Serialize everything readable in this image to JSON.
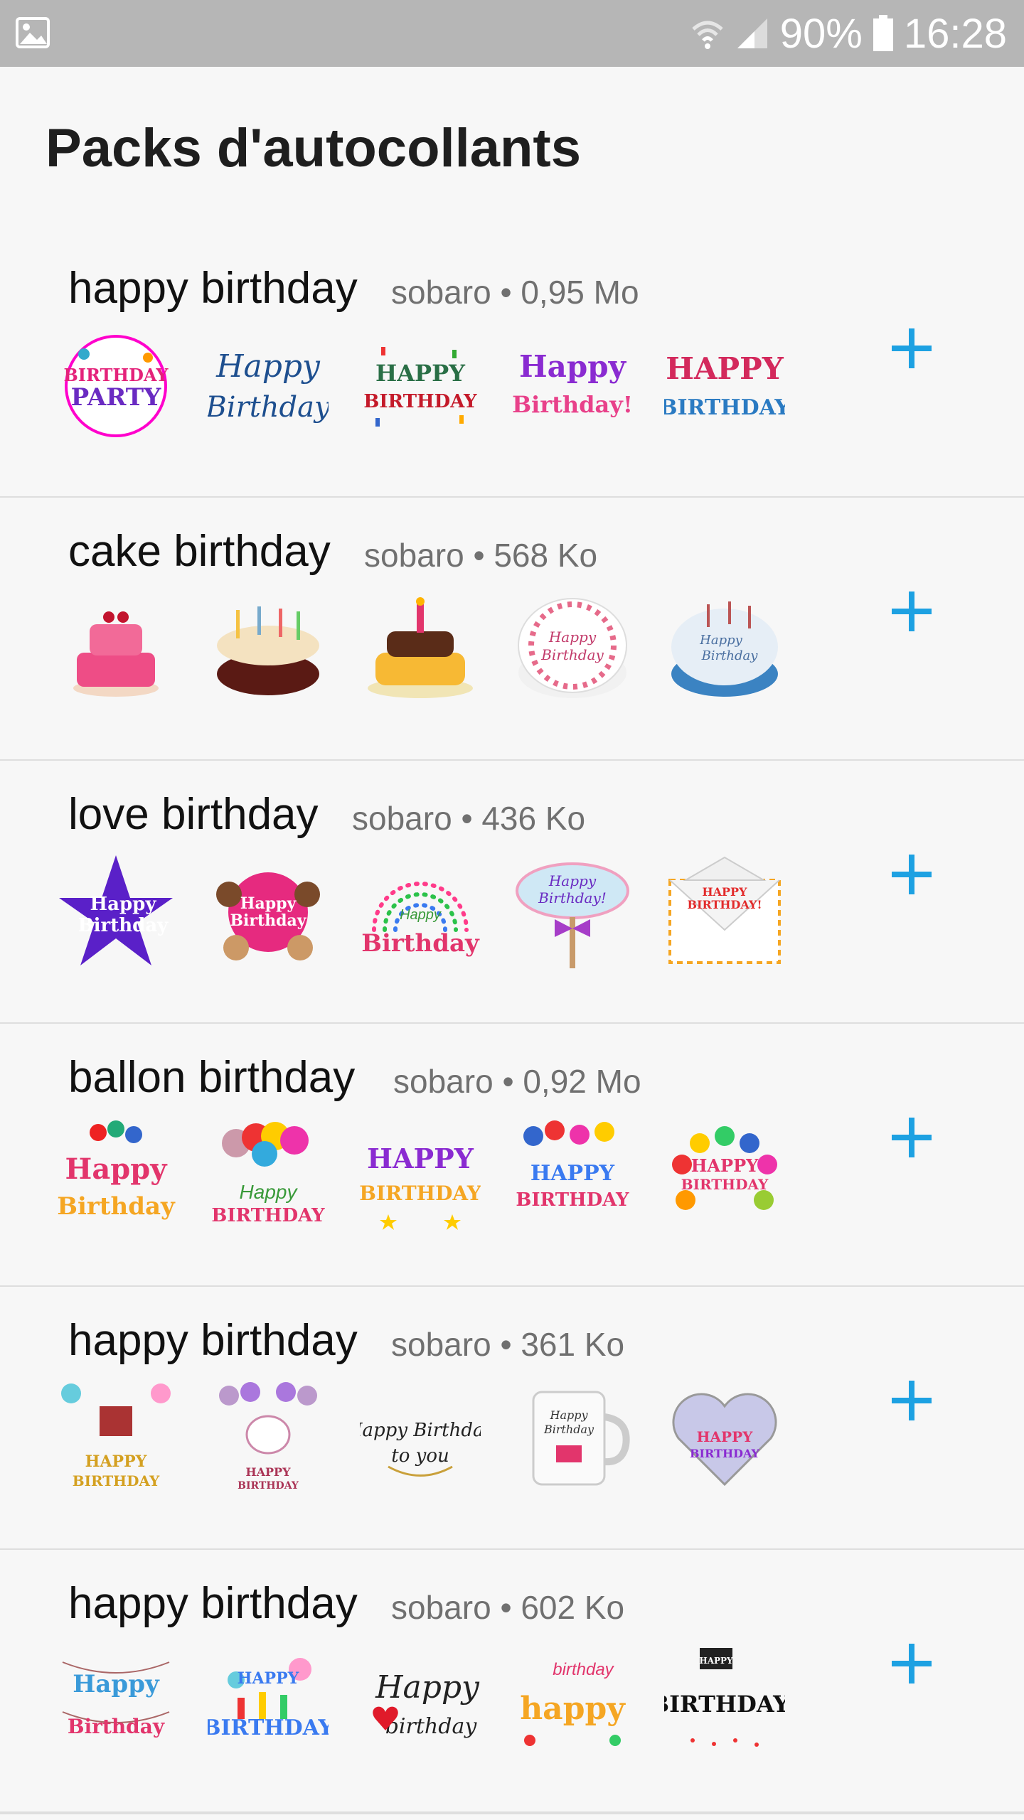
{
  "status_bar": {
    "battery": "90%",
    "time": "16:28",
    "icons": [
      "image-icon",
      "wifi-icon",
      "signal-icon",
      "battery-icon"
    ]
  },
  "title": "Packs d'autocollants",
  "colors": {
    "accent": "#1da1e2",
    "status_bar": "#b6b6b6",
    "background": "#f7f7f7"
  },
  "packs": [
    {
      "name": "happy birthday",
      "publisher": "sobaro",
      "separator": "•",
      "size": "0,95 Mo",
      "stickers": [
        {
          "line1": "BIRTHDAY",
          "line2": "PARTY"
        },
        {
          "line1": "Happy",
          "line2": "Birthday"
        },
        {
          "line1": "HAPPY",
          "line2": "BIRTHDAY"
        },
        {
          "line1": "Happy",
          "line2": "Birthday!"
        },
        {
          "line1": "HAPPY",
          "line2": "BIRTHDAY"
        }
      ]
    },
    {
      "name": "cake birthday",
      "publisher": "sobaro",
      "separator": "•",
      "size": "568 Ko",
      "stickers": [
        {
          "line1": "",
          "line2": ""
        },
        {
          "line1": "",
          "line2": ""
        },
        {
          "line1": "",
          "line2": ""
        },
        {
          "line1": "Happy",
          "line2": "Birthday"
        },
        {
          "line1": "Happy",
          "line2": "Birthday"
        }
      ]
    },
    {
      "name": "love birthday",
      "publisher": "sobaro",
      "separator": "•",
      "size": "436 Ko",
      "stickers": [
        {
          "line1": "Happy",
          "line2": "Birthday"
        },
        {
          "line1": "Happy",
          "line2": "Birthday"
        },
        {
          "line1": "Happy",
          "line2": "Birthday"
        },
        {
          "line1": "Happy",
          "line2": "Birthday!"
        },
        {
          "line1": "HAPPY",
          "line2": "BIRTHDAY!"
        }
      ]
    },
    {
      "name": "ballon birthday",
      "publisher": "sobaro",
      "separator": "•",
      "size": "0,92 Mo",
      "stickers": [
        {
          "line1": "Happy",
          "line2": "Birthday"
        },
        {
          "line1": "Happy",
          "line2": "BIRTHDAY"
        },
        {
          "line1": "HAPPY",
          "line2": "BIRTHDAY"
        },
        {
          "line1": "HAPPY",
          "line2": "BIRTHDAY"
        },
        {
          "line1": "HAPPY",
          "line2": "BIRTHDAY"
        }
      ]
    },
    {
      "name": "happy birthday",
      "publisher": "sobaro",
      "separator": "•",
      "size": "361 Ko",
      "stickers": [
        {
          "line1": "HAPPY",
          "line2": "BIRTHDAY"
        },
        {
          "line1": "HAPPY",
          "line2": "BIRTHDAY"
        },
        {
          "line1": "Happy Birthday",
          "line2": "to you"
        },
        {
          "line1": "Happy",
          "line2": "Birthday"
        },
        {
          "line1": "HAPPY",
          "line2": "BIRTHDAY"
        }
      ]
    },
    {
      "name": "happy birthday",
      "publisher": "sobaro",
      "separator": "•",
      "size": "602 Ko",
      "stickers": [
        {
          "line1": "Happy",
          "line2": "Birthday"
        },
        {
          "line1": "HAPPY",
          "line2": "BIRTHDAY"
        },
        {
          "line1": "Happy",
          "line2": "birthday"
        },
        {
          "line1": "birthday",
          "line2": "happy"
        },
        {
          "line1": "HAPPY",
          "line2": "BIRTHDAY!"
        }
      ]
    }
  ]
}
